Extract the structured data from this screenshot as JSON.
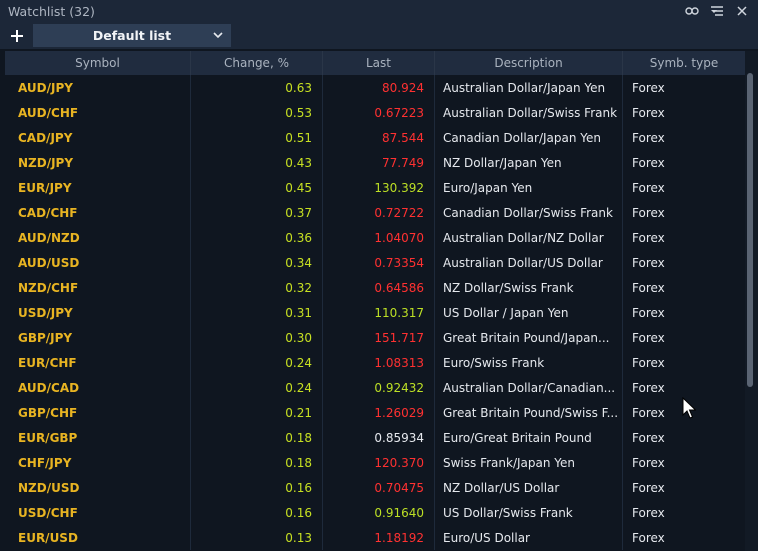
{
  "window": {
    "title": "Watchlist (32)"
  },
  "toolbar": {
    "list_name": "Default list"
  },
  "table": {
    "columns": [
      "Symbol",
      "Change, %",
      "Last",
      "Description",
      "Symb. type"
    ],
    "rows": [
      {
        "symbol": "AUD/JPY",
        "change": "0.63",
        "last": "80.924",
        "last_dir": "down",
        "description": "Australian Dollar/Japan Yen",
        "type": "Forex"
      },
      {
        "symbol": "AUD/CHF",
        "change": "0.53",
        "last": "0.67223",
        "last_dir": "down",
        "description": "Australian Dollar/Swiss Frank",
        "type": "Forex"
      },
      {
        "symbol": "CAD/JPY",
        "change": "0.51",
        "last": "87.544",
        "last_dir": "down",
        "description": "Canadian Dollar/Japan Yen",
        "type": "Forex"
      },
      {
        "symbol": "NZD/JPY",
        "change": "0.43",
        "last": "77.749",
        "last_dir": "down",
        "description": "NZ Dollar/Japan Yen",
        "type": "Forex"
      },
      {
        "symbol": "EUR/JPY",
        "change": "0.45",
        "last": "130.392",
        "last_dir": "up",
        "description": "Euro/Japan Yen",
        "type": "Forex"
      },
      {
        "symbol": "CAD/CHF",
        "change": "0.37",
        "last": "0.72722",
        "last_dir": "down",
        "description": "Canadian Dollar/Swiss Frank",
        "type": "Forex"
      },
      {
        "symbol": "AUD/NZD",
        "change": "0.36",
        "last": "1.04070",
        "last_dir": "down",
        "description": "Australian Dollar/NZ Dollar",
        "type": "Forex"
      },
      {
        "symbol": "AUD/USD",
        "change": "0.34",
        "last": "0.73354",
        "last_dir": "down",
        "description": "Australian Dollar/US Dollar",
        "type": "Forex"
      },
      {
        "symbol": "NZD/CHF",
        "change": "0.32",
        "last": "0.64586",
        "last_dir": "down",
        "description": "NZ Dollar/Swiss Frank",
        "type": "Forex"
      },
      {
        "symbol": "USD/JPY",
        "change": "0.31",
        "last": "110.317",
        "last_dir": "up",
        "description": "US Dollar / Japan Yen",
        "type": "Forex"
      },
      {
        "symbol": "GBP/JPY",
        "change": "0.30",
        "last": "151.717",
        "last_dir": "down",
        "description": "Great Britain Pound/Japan...",
        "type": "Forex"
      },
      {
        "symbol": "EUR/CHF",
        "change": "0.24",
        "last": "1.08313",
        "last_dir": "down",
        "description": "Euro/Swiss Frank",
        "type": "Forex"
      },
      {
        "symbol": "AUD/CAD",
        "change": "0.24",
        "last": "0.92432",
        "last_dir": "up",
        "description": "Australian Dollar/Canadian...",
        "type": "Forex"
      },
      {
        "symbol": "GBP/CHF",
        "change": "0.21",
        "last": "1.26029",
        "last_dir": "down",
        "description": "Great Britain Pound/Swiss F...",
        "type": "Forex"
      },
      {
        "symbol": "EUR/GBP",
        "change": "0.18",
        "last": "0.85934",
        "last_dir": "flat",
        "description": "Euro/Great Britain Pound",
        "type": "Forex"
      },
      {
        "symbol": "CHF/JPY",
        "change": "0.18",
        "last": "120.370",
        "last_dir": "down",
        "description": "Swiss Frank/Japan Yen",
        "type": "Forex"
      },
      {
        "symbol": "NZD/USD",
        "change": "0.16",
        "last": "0.70475",
        "last_dir": "down",
        "description": "NZ Dollar/US Dollar",
        "type": "Forex"
      },
      {
        "symbol": "USD/CHF",
        "change": "0.16",
        "last": "0.91640",
        "last_dir": "up",
        "description": "US Dollar/Swiss Frank",
        "type": "Forex"
      },
      {
        "symbol": "EUR/USD",
        "change": "0.13",
        "last": "1.18192",
        "last_dir": "down",
        "description": "Euro/US Dollar",
        "type": "Forex"
      }
    ]
  },
  "colors": {
    "symbol": "#e8b422",
    "change_positive": "#c7e022",
    "last_up": "#bde025",
    "last_down": "#ff3131",
    "last_flat": "#e6e9ee",
    "header_bg": "#1c2738"
  },
  "icons": [
    "link-icon",
    "filter-settings-icon",
    "close-icon",
    "plus-icon",
    "chevron-down-icon"
  ]
}
